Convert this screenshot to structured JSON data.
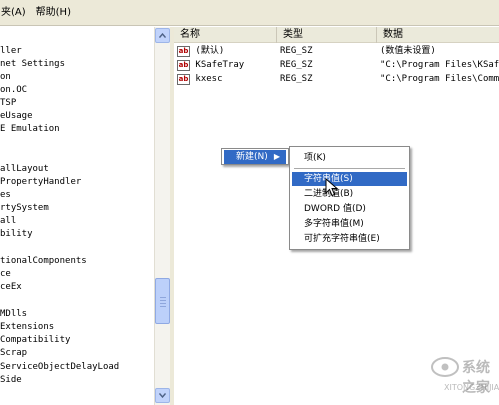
{
  "menubar": {
    "items": [
      {
        "label": "夹(A)"
      },
      {
        "label": "帮助(H)"
      }
    ]
  },
  "tree": {
    "items": [
      "ller",
      "net Settings",
      "on",
      "on.OC",
      "TSP",
      "eUsage",
      "E Emulation",
      "",
      "",
      "allLayout",
      "PropertyHandler",
      "es",
      "rtySystem",
      "all",
      "bility",
      "",
      "tionalComponents",
      "ce",
      "ceEx",
      "",
      "MDlls",
      " Extensions",
      "Compatibility",
      "Scrap",
      "ServiceObjectDelayLoad",
      "Side"
    ]
  },
  "list": {
    "columns": [
      "名称",
      "类型",
      "数据"
    ],
    "rows": [
      {
        "name": "(默认)",
        "type": "REG_SZ",
        "data": "(数值未设置)"
      },
      {
        "name": "KSafeTray",
        "type": "REG_SZ",
        "data": "\"C:\\Program Files\\KSafe\\"
      },
      {
        "name": "kxesc",
        "type": "REG_SZ",
        "data": "\"C:\\Program Files\\Common"
      }
    ]
  },
  "context_menu": {
    "new_label": "新建(N)",
    "submenu": [
      "项(K)",
      "字符串值(S)",
      "二进制值(B)",
      "DWORD 值(D)",
      "多字符串值(M)",
      "可扩充字符串值(E)"
    ],
    "highlighted_index": 1
  },
  "watermark": {
    "logo_text": "系统之家",
    "url_text": "XITONGZHIJIA.NET"
  },
  "colors": {
    "menu_highlight": "#316ac5",
    "scrollbar": "#c1d3fb",
    "chrome": "#ece9d8"
  }
}
